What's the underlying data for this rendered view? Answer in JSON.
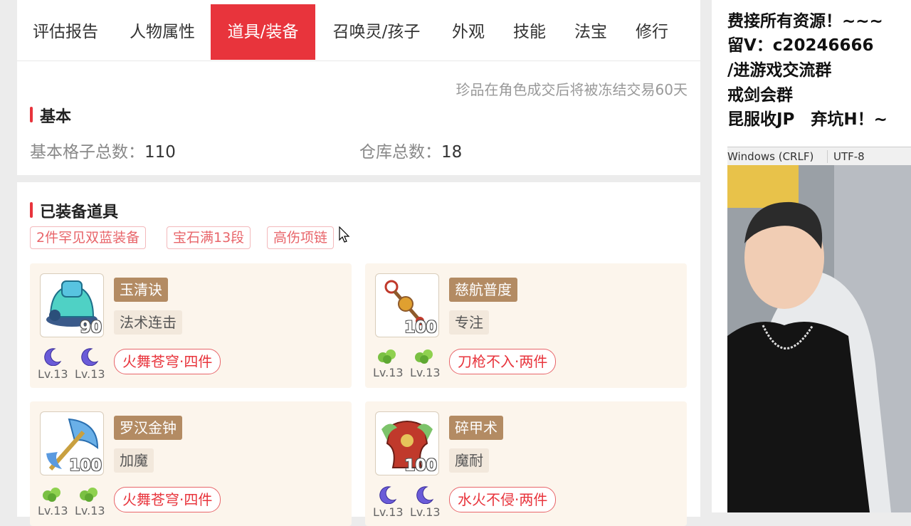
{
  "tabs": [
    "评估报告",
    "人物属性",
    "道具/装备",
    "召唤灵/孩子",
    "外观",
    "技能",
    "法宝",
    "修行"
  ],
  "active_tab": "道具/装备",
  "basic": {
    "notice": "珍品在角色成交后将被冻结交易60天",
    "title": "基本",
    "slots_label": "基本格子总数：",
    "slots_value": "110",
    "storage_label": "仓库总数：",
    "storage_value": "18"
  },
  "equipped": {
    "title": "已装备道具",
    "tags": [
      "2件罕见双蓝装备",
      "宝石满13段",
      "高伤项链"
    ],
    "items": [
      {
        "icon": "helmet-icon",
        "level": "90",
        "name": "玉清诀",
        "effect": "法术连击",
        "gems": [
          {
            "type": "moon",
            "lv": "Lv.13"
          },
          {
            "type": "moon",
            "lv": "Lv.13"
          }
        ],
        "set": "火舞苍穹·四件"
      },
      {
        "icon": "necklace-icon",
        "level": "100",
        "name": "慈航普度",
        "effect": "专注",
        "gems": [
          {
            "type": "leaf",
            "lv": "Lv.13"
          },
          {
            "type": "leaf",
            "lv": "Lv.13"
          }
        ],
        "set": "刀枪不入·两件"
      },
      {
        "icon": "axe-weapon-icon",
        "level": "100",
        "name": "罗汉金钟",
        "effect": "加魔",
        "gems": [
          {
            "type": "leaf",
            "lv": "Lv.13"
          },
          {
            "type": "leaf",
            "lv": "Lv.13"
          }
        ],
        "set": "火舞苍穹·四件"
      },
      {
        "icon": "armor-icon",
        "level": "100",
        "name": "碎甲术",
        "effect": "魔耐",
        "gems": [
          {
            "type": "moon",
            "lv": "Lv.13"
          },
          {
            "type": "moon",
            "lv": "Lv.13"
          }
        ],
        "set": "水火不侵·两件"
      }
    ]
  },
  "overlay": {
    "lines": [
      "费接所有资源！~~~",
      "留V：c20246666",
      "/进游戏交流群",
      "戒剑会群",
      "昆服收JP　弃坑H！~"
    ],
    "status_eol": "Windows (CRLF)",
    "status_enc": "UTF-8"
  }
}
